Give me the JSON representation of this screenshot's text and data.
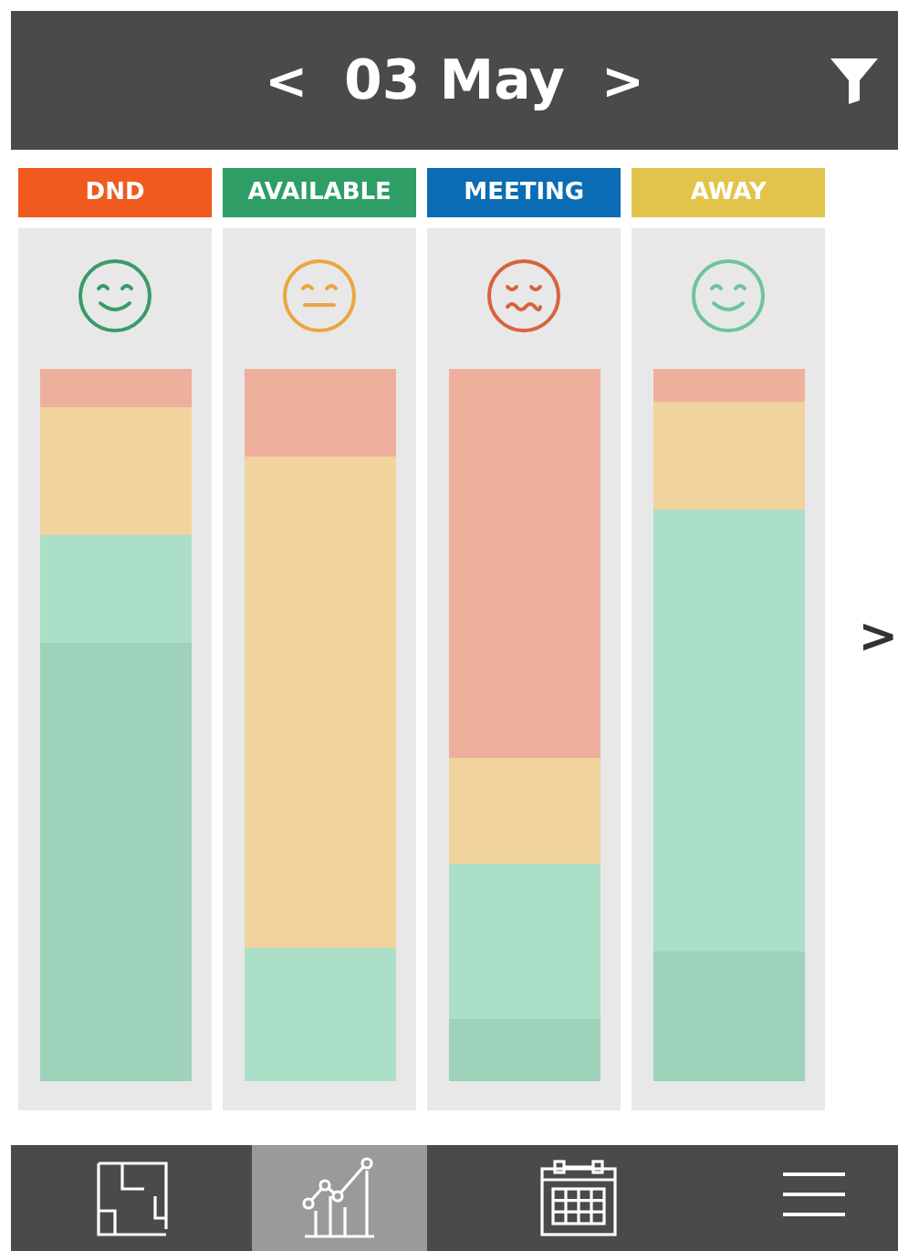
{
  "header": {
    "prev": "<",
    "date": "03 May",
    "next": ">"
  },
  "columns": [
    {
      "label": "DND",
      "color": "#f05a1e",
      "face": {
        "kind": "happy",
        "color": "#3a9a6a"
      }
    },
    {
      "label": "AVAILABLE",
      "color": "#2e9e66",
      "face": {
        "kind": "neutral",
        "color": "#eaa640"
      }
    },
    {
      "label": "MEETING",
      "color": "#0a6cb4",
      "face": {
        "kind": "worried",
        "color": "#d8623e"
      }
    },
    {
      "label": "AWAY",
      "color": "#e3c44a",
      "face": {
        "kind": "happy",
        "color": "#6cc59a"
      }
    }
  ],
  "next_page": ">",
  "nav": [
    {
      "kind": "floorplan",
      "selected": false
    },
    {
      "kind": "chart",
      "selected": true
    },
    {
      "kind": "calendar",
      "selected": false
    },
    {
      "kind": "menu",
      "selected": false
    }
  ]
}
